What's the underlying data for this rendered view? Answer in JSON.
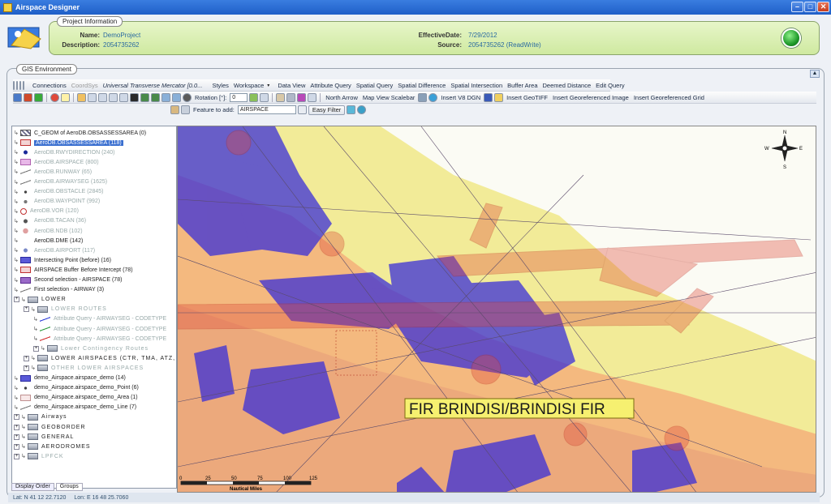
{
  "window": {
    "title": "Airspace Designer"
  },
  "project": {
    "legend": "Project Information",
    "name_label": "Name:",
    "name_value": "DemoProject",
    "description_label": "Description:",
    "description_value": "2054735262",
    "effective_label": "EffectiveDate:",
    "effective_value": "7/29/2012",
    "source_label": "Source:",
    "source_value": "2054735262 (ReadWrite)"
  },
  "gis": {
    "legend": "GIS Environment"
  },
  "toolbar1": {
    "connections": "Connections",
    "coordsys": "CoordSys",
    "projection": "Universal Transverse Mercator [0.0...",
    "styles": "Styles",
    "workspace": "Workspace",
    "data_view": "Data View",
    "attribute_query": "Attribute Query",
    "spatial_query": "Spatial Query",
    "spatial_difference": "Spatial Difference",
    "spatial_intersection": "Spatial Intersection",
    "buffer_area": "Buffer Area",
    "deemed_distance": "Deemed Distance",
    "edit_query": "Edit Query"
  },
  "toolbar2": {
    "rotation_label": "Rotation [°]:",
    "rotation_value": "0",
    "north_arrow": "North Arrow",
    "scalebar": "Map View Scalebar",
    "insert_dgn": "Insert V8 DGN",
    "insert_geotiff": "Insert GeoTIFF",
    "insert_georef_image": "Insert Georeferenced Image",
    "insert_georef_grid": "Insert Georeferenced Grid"
  },
  "toolbar3": {
    "feature_label": "Feature to add:",
    "feature_value": "AIRSPACE",
    "easy_filter": "Easy Filter"
  },
  "layers": [
    {
      "label": "C_GEOM of AeroDB.OBSASSESSAREA (0)",
      "indent": 0,
      "dim": false,
      "sym": "hatch"
    },
    {
      "label": "AeroDB.OBSASSESSAREA (118)",
      "indent": 0,
      "dim": false,
      "sym": "redbox",
      "selected": true
    },
    {
      "label": "AeroDB.RWYDIRECTION (240)",
      "indent": 0,
      "dim": true,
      "sym": "dot"
    },
    {
      "label": "AeroDB.AIRSPACE (800)",
      "indent": 0,
      "dim": true,
      "sym": "pink"
    },
    {
      "label": "AeroDB.RUNWAY (65)",
      "indent": 0,
      "dim": true,
      "sym": "line"
    },
    {
      "label": "AeroDB.AIRWAYSEG (1625)",
      "indent": 0,
      "dim": true,
      "sym": "line"
    },
    {
      "label": "AeroDB.OBSTACLE (2845)",
      "indent": 0,
      "dim": true,
      "sym": "smalldot"
    },
    {
      "label": "AeroDB.WAYPOINT (992)",
      "indent": 0,
      "dim": true,
      "sym": "tri"
    },
    {
      "label": "AeroDB.VOR (120)",
      "indent": 0,
      "dim": true,
      "sym": "circle"
    },
    {
      "label": "AeroDB.TACAN (36)",
      "indent": 0,
      "dim": true,
      "sym": "tacan"
    },
    {
      "label": "AeroDB.NDB (102)",
      "indent": 0,
      "dim": true,
      "sym": "ndb"
    },
    {
      "label": "AeroDB.DME (142)",
      "indent": 0,
      "dim": false,
      "sym": "none"
    },
    {
      "label": "AeroDB.AIRPORT (117)",
      "indent": 0,
      "dim": true,
      "sym": "airport"
    },
    {
      "label": "Intersecting Point (before) (16)",
      "indent": 0,
      "dim": false,
      "sym": "bluebox"
    },
    {
      "label": "AIRSPACE Buffer Before Intercept (78)",
      "indent": 0,
      "dim": false,
      "sym": "redbox"
    },
    {
      "label": "Second selection - AIRSPACE (78)",
      "indent": 0,
      "dim": false,
      "sym": "purple"
    },
    {
      "label": "First selection - AIRWAY (3)",
      "indent": 0,
      "dim": false,
      "sym": "line"
    },
    {
      "label": "LOWER",
      "indent": 0,
      "dim": false,
      "sym": "folder",
      "group": true
    },
    {
      "label": "LOWER ROUTES",
      "indent": 1,
      "dim": true,
      "sym": "folder",
      "group": true
    },
    {
      "label": "Attribute Query - AIRWAYSEG - CODETYPE",
      "indent": 2,
      "dim": true,
      "sym": "blueline"
    },
    {
      "label": "Attribute Query - AIRWAYSEG - CODETYPE",
      "indent": 2,
      "dim": true,
      "sym": "greenline"
    },
    {
      "label": "Attribute Query - AIRWAYSEG - CODETYPE",
      "indent": 2,
      "dim": true,
      "sym": "redline"
    },
    {
      "label": "Lower Contingency Routes",
      "indent": 2,
      "dim": true,
      "sym": "folder",
      "group": true
    },
    {
      "label": "LOWER AIRSPACES (CTR, TMA, ATZ, FI...",
      "indent": 1,
      "dim": false,
      "sym": "folder",
      "group": true
    },
    {
      "label": "OTHER LOWER AIRSPACES",
      "indent": 1,
      "dim": true,
      "sym": "folder",
      "group": true
    },
    {
      "label": "demo_Airspace.airspace_demo (14)",
      "indent": 0,
      "dim": false,
      "sym": "bluebox"
    },
    {
      "label": "demo_Airspace.airspace_demo_Point (6)",
      "indent": 0,
      "dim": false,
      "sym": "smalldot"
    },
    {
      "label": "demo_Airspace.airspace_demo_Area (1)",
      "indent": 0,
      "dim": false,
      "sym": "pinkbox"
    },
    {
      "label": "demo_Airspace.airspace_demo_Line (7)",
      "indent": 0,
      "dim": false,
      "sym": "line"
    },
    {
      "label": "Airways",
      "indent": 0,
      "dim": false,
      "sym": "folder",
      "group": true
    },
    {
      "label": "GEOBORDER",
      "indent": 0,
      "dim": false,
      "sym": "folder",
      "group": true
    },
    {
      "label": "GENERAL",
      "indent": 0,
      "dim": false,
      "sym": "folder",
      "group": true
    },
    {
      "label": "AERODROMES",
      "indent": 0,
      "dim": false,
      "sym": "folder",
      "group": true
    },
    {
      "label": "LPFCK",
      "indent": 0,
      "dim": true,
      "sym": "folder",
      "group": true
    }
  ],
  "panel_tabs": {
    "display_order": "Display Order",
    "groups": "Groups"
  },
  "map": {
    "fir_label": "FIR BRINDISI/BRINDISI FIR",
    "scale_ticks": [
      "0",
      "25",
      "50",
      "75",
      "100",
      "125"
    ],
    "scale_unit": "Nautical Miles",
    "compass": {
      "n": "N",
      "s": "S",
      "e": "E",
      "w": "W"
    }
  },
  "status": {
    "lat": "Lat:  N 41 12 22.7120",
    "lon": "Lon:  E 16 48 25.7060"
  },
  "colors": {
    "accent": "#1f5fc8",
    "panel": "#d4ebaa",
    "airspace_blue": "#3a2fd8",
    "buffer_red": "#e04a3a",
    "fir_yellow": "#f2eb98"
  }
}
